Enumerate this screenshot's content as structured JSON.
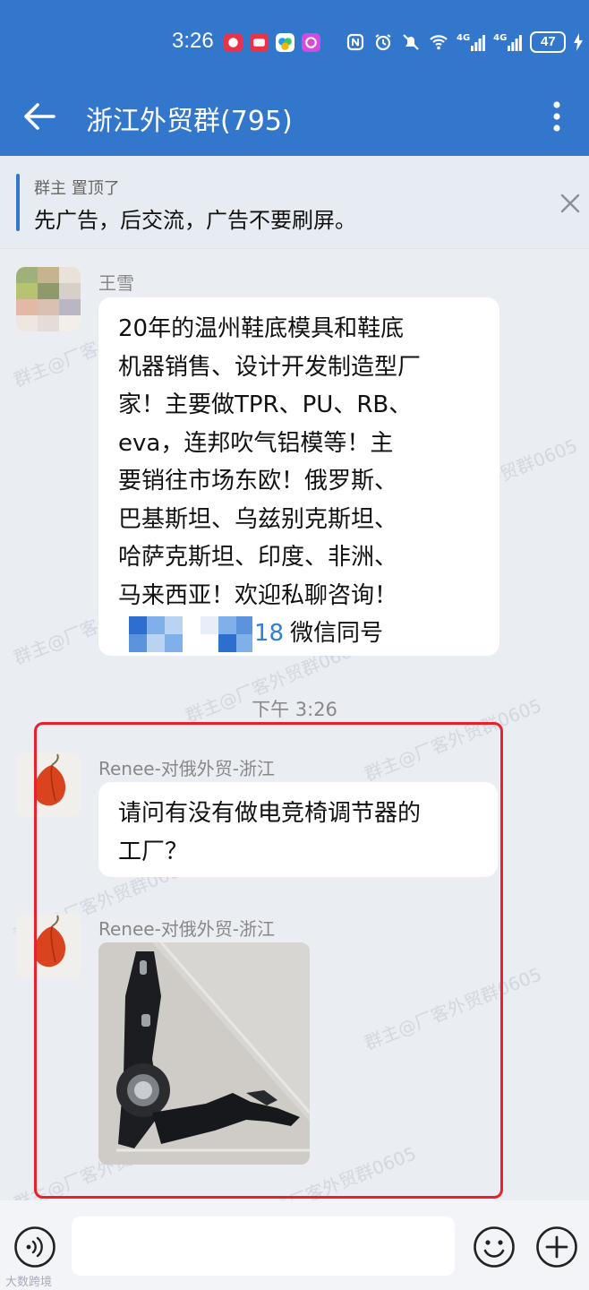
{
  "status_bar": {
    "time": "3:26",
    "network_1": "4G",
    "network_2": "4G",
    "battery": "47"
  },
  "header": {
    "title": "浙江外贸群(795)"
  },
  "pinned": {
    "meta": "群主 置顶了",
    "text": "先广告，后交流，广告不要刷屏。"
  },
  "messages": [
    {
      "sender": "王雪",
      "lines": [
        "20年的温州鞋底模具和鞋底",
        "机器销售、设计开发制造型厂",
        "家！主要做TPR、PU、RB、",
        "eva，连邦吹气铝模等！主",
        "要销往市场东欧！俄罗斯、",
        "巴基斯坦、乌兹别克斯坦、",
        "哈萨克斯坦、印度、非洲、",
        "马来西亚！欢迎私聊咨询！"
      ],
      "contact_suffix": "18",
      "contact_label": "微信同号"
    },
    {
      "sender": "Renee-对俄外贸-浙江",
      "lines": [
        "请问有没有做电竞椅调节器的",
        "工厂？"
      ]
    },
    {
      "sender": "Renee-对俄外贸-浙江",
      "image": "seat-adjuster-photo"
    }
  ],
  "time_divider": "下午 3:26",
  "watermark": "群主@厂客外贸群0605",
  "footer_watermark": "大数跨境",
  "colors": {
    "header": "#3377cc",
    "highlight_frame": "#e8212c",
    "link": "#2f7ed8"
  }
}
